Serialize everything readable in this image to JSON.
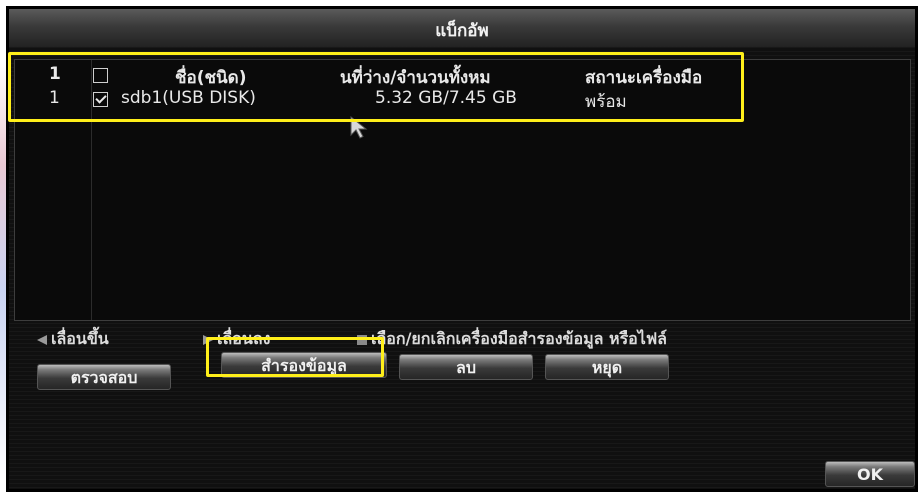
{
  "dialog": {
    "title": "แบ็กอัพ"
  },
  "table": {
    "header": {
      "index": "1",
      "checked": false,
      "name": "ชื่อ(ชนิด)",
      "free_total": "นที่ว่าง/จำนวนทั้งหม",
      "status": "สถานะเครื่องมือ"
    },
    "rows": [
      {
        "index": "1",
        "checked": true,
        "name": "sdb1(USB DISK)",
        "free_total": "5.32 GB/7.45 GB",
        "status": "พร้อม"
      }
    ]
  },
  "nav": {
    "scroll_up": "เลื่อนขึ้น",
    "scroll_down": "เลื่อนลง",
    "select_hint": "เลือก/ยกเลิกเครื่องมือสำรองข้อมูล หรือไฟล์"
  },
  "buttons": {
    "check": "ตรวจสอบ",
    "backup": "สำรองข้อมูล",
    "delete": "ลบ",
    "stop": "หยุด",
    "ok": "OK"
  },
  "colors": {
    "highlight": "#ffef1a",
    "panel": "#101010"
  }
}
